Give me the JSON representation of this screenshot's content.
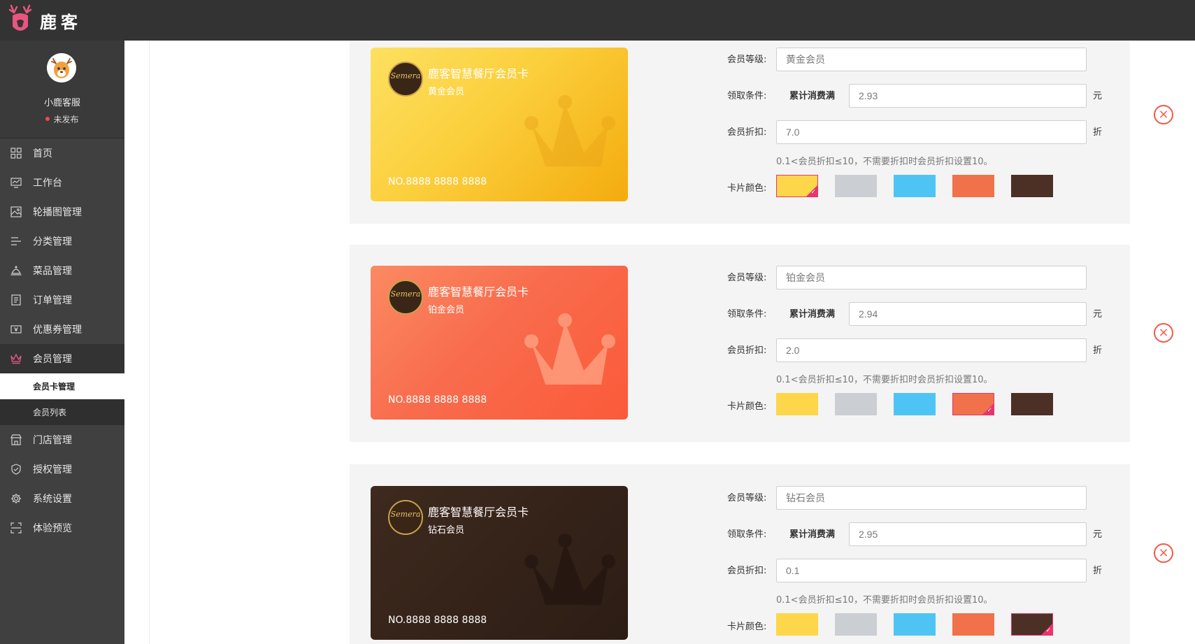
{
  "app": {
    "brand": "鹿客"
  },
  "profile": {
    "name": "小鹿客服",
    "status": "未发布"
  },
  "sidebar": {
    "items": [
      {
        "label": "首页",
        "icon": "grid-icon"
      },
      {
        "label": "工作台",
        "icon": "monitor-icon"
      },
      {
        "label": "轮播图管理",
        "icon": "image-icon"
      },
      {
        "label": "分类管理",
        "icon": "list-icon"
      },
      {
        "label": "菜品管理",
        "icon": "dish-cover-icon"
      },
      {
        "label": "订单管理",
        "icon": "document-icon"
      },
      {
        "label": "优惠券管理",
        "icon": "coupon-icon"
      },
      {
        "label": "会员管理",
        "icon": "crown-icon"
      },
      {
        "label": "门店管理",
        "icon": "store-icon"
      },
      {
        "label": "授权管理",
        "icon": "shield-icon"
      },
      {
        "label": "系统设置",
        "icon": "gear-icon"
      },
      {
        "label": "体验预览",
        "icon": "scan-icon"
      }
    ],
    "sub_items": [
      {
        "label": "会员卡管理"
      },
      {
        "label": "会员列表"
      }
    ]
  },
  "form": {
    "level_label": "会员等级:",
    "condition_label": "领取条件:",
    "condition_text": "累计消费满",
    "discount_label": "会员折扣:",
    "color_label": "卡片颜色:",
    "unit_yuan": "元",
    "unit_zhe": "折",
    "hint": "0.1<会员折扣≤10，不需要折扣时会员折扣设置10。"
  },
  "palette": [
    "#fdd64a",
    "#cbced2",
    "#4ec4f5",
    "#f1724a",
    "#4c3026"
  ],
  "cards": [
    {
      "card_name": "鹿客智慧餐厅会员卡",
      "level": "黄金会员",
      "number": "NO.8888 8888 8888",
      "logo_text": "Semera",
      "level_value": "黄金会员",
      "condition_value": "2.93",
      "discount_value": "7.0",
      "selected_color_index": 0
    },
    {
      "card_name": "鹿客智慧餐厅会员卡",
      "level": "铂金会员",
      "number": "NO.8888 8888 8888",
      "logo_text": "Semera",
      "level_value": "铂金会员",
      "condition_value": "2.94",
      "discount_value": "2.0",
      "selected_color_index": 3
    },
    {
      "card_name": "鹿客智慧餐厅会员卡",
      "level": "钻石会员",
      "number": "NO.8888 8888 8888",
      "logo_text": "Semera",
      "level_value": "钻石会员",
      "condition_value": "2.95",
      "discount_value": "0.1",
      "selected_color_index": 4
    }
  ]
}
